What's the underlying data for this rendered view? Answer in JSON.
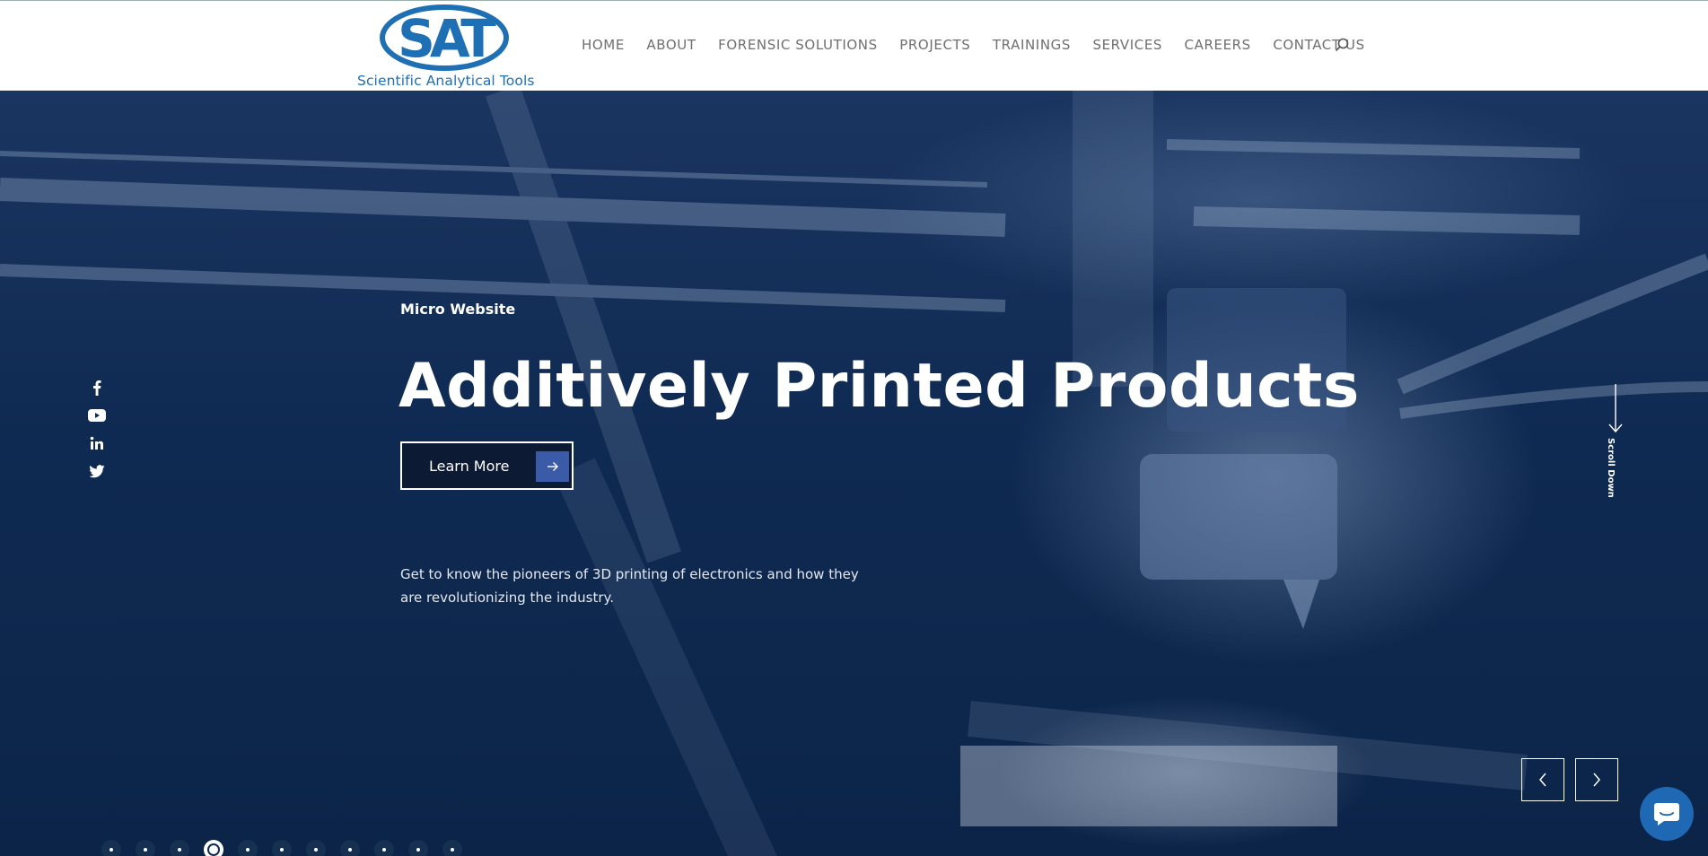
{
  "brand": {
    "logo_letters": "SAT",
    "name": "Scientific Analytical Tools",
    "color": "#1f6fb5"
  },
  "nav": {
    "items": [
      {
        "label": "HOME"
      },
      {
        "label": "ABOUT"
      },
      {
        "label": "FORENSIC SOLUTIONS"
      },
      {
        "label": "PROJECTS"
      },
      {
        "label": "TRAININGS"
      },
      {
        "label": "SERVICES"
      },
      {
        "label": "CAREERS"
      },
      {
        "label": "CONTACT US"
      }
    ],
    "search_icon": "search-icon"
  },
  "hero": {
    "eyebrow": "Micro Website",
    "headline": "Additively Printed Products",
    "cta_label": "Learn More",
    "cta_icon": "arrow-right-icon",
    "description": "Get to know the pioneers of 3D printing of electronics and how they are revolutionizing the industry.",
    "scroll_label": "Scroll Down",
    "overlay_color": "#0f2a52",
    "accent_color": "#3b5ba8"
  },
  "social": [
    {
      "icon": "facebook-icon"
    },
    {
      "icon": "youtube-icon"
    },
    {
      "icon": "linkedin-icon"
    },
    {
      "icon": "twitter-icon"
    }
  ],
  "slider": {
    "slide_count": 11,
    "active_slide": 4,
    "prev_icon": "chevron-left-icon",
    "next_icon": "chevron-right-icon"
  },
  "chat": {
    "icon": "chat-icon"
  }
}
